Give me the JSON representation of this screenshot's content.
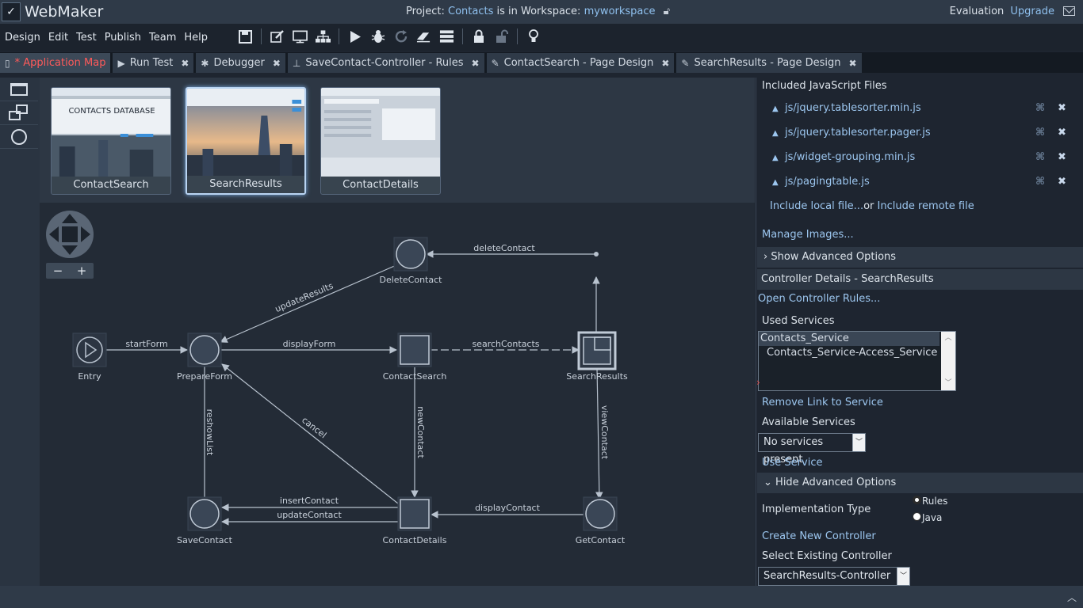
{
  "app": {
    "name": "WebMaker"
  },
  "header": {
    "project_prefix": "Project:",
    "project_name": "Contacts",
    "workspace_prefix": "is in Workspace:",
    "workspace_name": "myworkspace",
    "evaluation": "Evaluation",
    "upgrade": "Upgrade"
  },
  "menu": [
    "Design",
    "Edit",
    "Test",
    "Publish",
    "Team",
    "Help"
  ],
  "toolbar_icons": [
    "save-icon",
    "edit-icon",
    "monitor-icon",
    "sitemap-icon",
    "run-icon",
    "debug-icon",
    "refresh-icon",
    "eraser-icon",
    "server-icon",
    "lock-icon",
    "unlock-icon",
    "lightbulb-icon"
  ],
  "tabs": [
    {
      "label": "* Application Map",
      "icon": "map-icon",
      "active": true
    },
    {
      "label": "Run Test",
      "icon": "run-icon"
    },
    {
      "label": "Debugger",
      "icon": "debug-icon"
    },
    {
      "label": "SaveContact-Controller - Rules",
      "icon": "sitemap-icon"
    },
    {
      "label": "ContactSearch - Page Design",
      "icon": "edit-icon"
    },
    {
      "label": "SearchResults - Page Design",
      "icon": "edit-icon"
    }
  ],
  "pages": [
    {
      "label": "ContactSearch",
      "preview_title": "CONTACTS DATABASE"
    },
    {
      "label": "SearchResults",
      "selected": true
    },
    {
      "label": "ContactDetails"
    }
  ],
  "zoom": {
    "minus": "−",
    "plus": "+"
  },
  "diagram": {
    "nodes": {
      "entry": "Entry",
      "prepare": "PrepareForm",
      "delete": "DeleteContact",
      "search": "ContactSearch",
      "results": "SearchResults",
      "save": "SaveContact",
      "details": "ContactDetails",
      "get": "GetContact"
    },
    "edges": {
      "startForm": "startForm",
      "displayForm": "displayForm",
      "searchContacts": "searchContacts",
      "deleteContact": "deleteContact",
      "updateResults": "updateResults",
      "reshowList": "reshowList",
      "cancel": "cancel",
      "newContact": "newContact",
      "viewContact": "viewContact",
      "insertContact": "insertContact",
      "updateContact": "updateContact",
      "displayContact": "displayContact"
    }
  },
  "panel": {
    "js_header": "Included JavaScript Files",
    "js_files": [
      "js/jquery.tablesorter.min.js",
      "js/jquery.tablesorter.pager.js",
      "js/widget-grouping.min.js",
      "js/pagingtable.js"
    ],
    "include_local": "Include local file...",
    "include_or": "or",
    "include_remote": "Include remote file",
    "manage_images": "Manage Images...",
    "show_advanced": "Show Advanced Options",
    "controller_details": "Controller Details - SearchResults",
    "open_rules": "Open Controller Rules...",
    "used_services": "Used Services",
    "services": [
      "Contacts_Service",
      "Contacts_Service-Access_Service"
    ],
    "remove_link": "Remove Link to Service",
    "available_services": "Available Services",
    "available_select": "No services present",
    "use_service": "Use Service",
    "hide_advanced": "Hide Advanced Options",
    "impl_type": "Implementation Type",
    "impl_rules": "Rules",
    "impl_java": "Java",
    "impl_selected": "Rules",
    "create_controller": "Create New Controller",
    "select_existing": "Select Existing Controller",
    "controller_select": "SearchResults-Controller"
  },
  "colors": {
    "accent_link": "#9cc6ef",
    "active_tab": "#ff5a5a",
    "diagram_line": "#b8c2ce"
  }
}
